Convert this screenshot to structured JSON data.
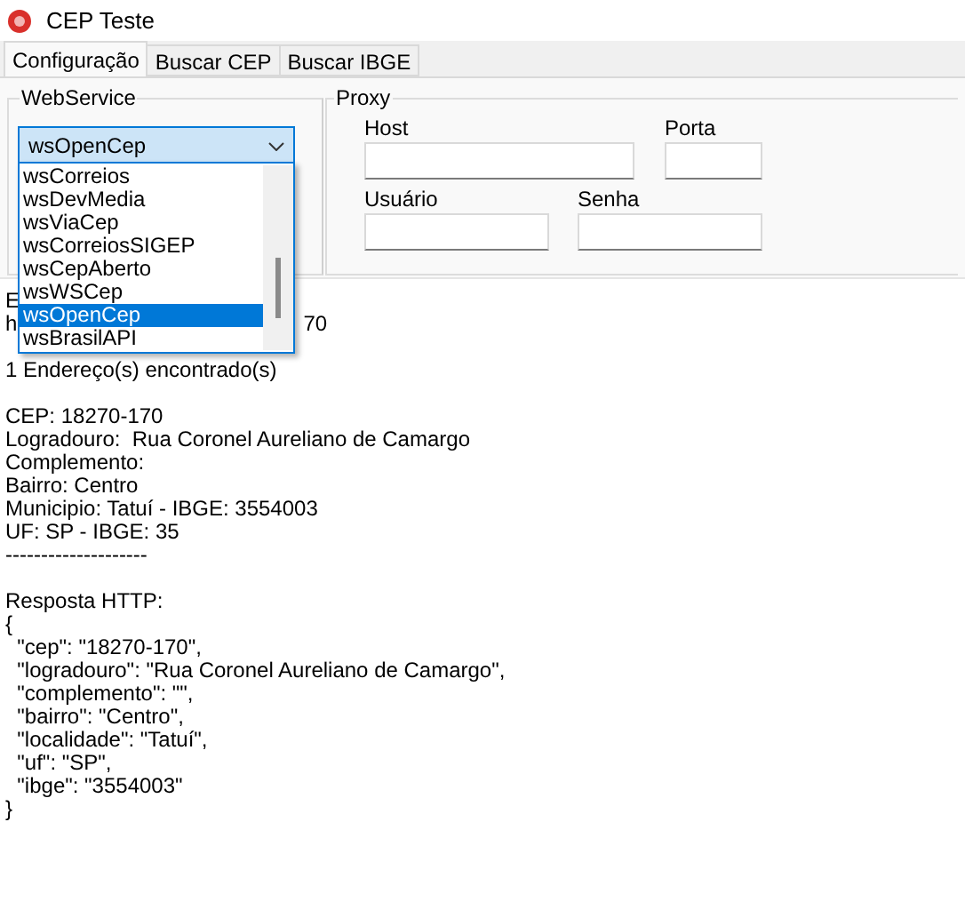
{
  "window": {
    "title": "CEP Teste"
  },
  "tabs": [
    {
      "label": "Configuração",
      "selected": true
    },
    {
      "label": "Buscar CEP",
      "selected": false
    },
    {
      "label": "Buscar IBGE",
      "selected": false
    }
  ],
  "webservice": {
    "title": "WebService",
    "value": "wsOpenCep",
    "expanded": true,
    "options": [
      {
        "label": "wsCorreios",
        "selected": false
      },
      {
        "label": "wsDevMedia",
        "selected": false
      },
      {
        "label": "wsViaCep",
        "selected": false
      },
      {
        "label": "wsCorreiosSIGEP",
        "selected": false
      },
      {
        "label": "wsCepAberto",
        "selected": false
      },
      {
        "label": "wsWSCep",
        "selected": false
      },
      {
        "label": "wsOpenCep",
        "selected": true
      },
      {
        "label": "wsBrasilAPI",
        "selected": false
      }
    ]
  },
  "proxy": {
    "title": "Proxy",
    "host": {
      "label": "Host"
    },
    "porta": {
      "label": "Porta"
    },
    "usuario": {
      "label": "Usuário"
    },
    "senha": {
      "label": "Senha"
    }
  },
  "memo": {
    "hidden_lines": [
      {
        "parts": [
          "E"
        ]
      },
      {
        "parts": [
          "h",
          "70"
        ]
      }
    ],
    "blocks": [
      [
        "1 Endereço(s) encontrado(s)"
      ],
      [
        "CEP: 18270-170",
        "Logradouro:  Rua Coronel Aureliano de Camargo",
        "Complemento:",
        "Bairro: Centro",
        "Municipio: Tatuí - IBGE: 3554003",
        "UF: SP - IBGE: 35",
        "--------------------"
      ],
      [
        "Resposta HTTP:",
        "{",
        "  \"cep\": \"18270-170\",",
        "  \"logradouro\": \"Rua Coronel Aureliano de Camargo\",",
        "  \"complemento\": \"\",",
        "  \"bairro\": \"Centro\",",
        "  \"localidade\": \"Tatuí\",",
        "  \"uf\": \"SP\",",
        "  \"ibge\": \"3554003\"",
        "}"
      ]
    ]
  }
}
